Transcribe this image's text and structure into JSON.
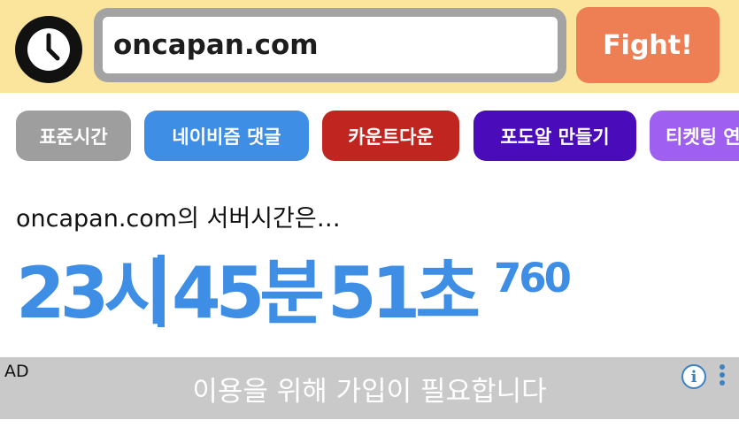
{
  "header": {
    "clock_icon": "clock-icon",
    "url_value": "oncapan.com",
    "fight_label": "Fight!"
  },
  "tabs": [
    {
      "label": "표준시간",
      "color": "#9e9e9e"
    },
    {
      "label": "네이비즘 댓글",
      "color": "#3d8ee4"
    },
    {
      "label": "카운트다운",
      "color": "#c0261f"
    },
    {
      "label": "포도알 만들기",
      "color": "#4a0bba"
    },
    {
      "label": "티켓팅 연",
      "color": "#9f5ff0"
    }
  ],
  "server_time": {
    "label": "oncapan.com의 서버시간은…",
    "hours": "23시",
    "minutes": "45분",
    "seconds": "51초",
    "millis": "760"
  },
  "ad": {
    "tag": "AD",
    "text": "이용을 위해 가입이 필요합니다",
    "info_icon": "info-icon",
    "more_icon": "more-vertical-icon"
  },
  "colors": {
    "topbar_bg": "#fbe59c",
    "fight_bg": "#ee7e53",
    "time_color": "#3d8ee4"
  }
}
